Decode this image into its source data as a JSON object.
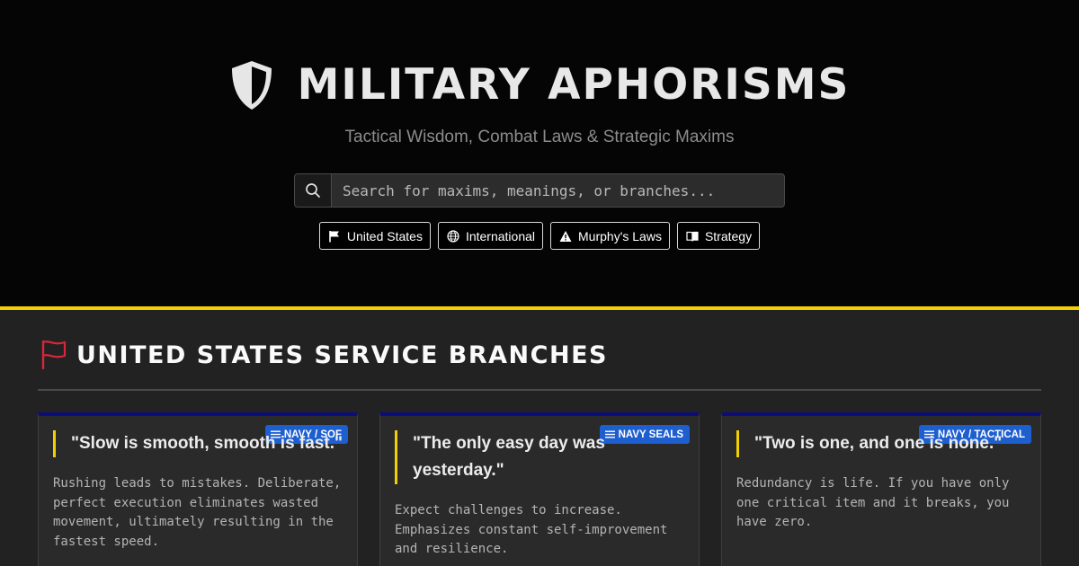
{
  "header": {
    "title": "MILITARY APHORISMS",
    "subtitle": "Tactical Wisdom, Combat Laws & Strategic Maxims",
    "search_placeholder": "Search for maxims, meanings, or branches...",
    "filters": [
      {
        "label": "United States",
        "icon": "flag-icon"
      },
      {
        "label": "International",
        "icon": "globe-icon"
      },
      {
        "label": "Murphy's Laws",
        "icon": "warning-icon"
      },
      {
        "label": "Strategy",
        "icon": "book-icon"
      }
    ]
  },
  "section": {
    "title": "UNITED STATES SERVICE BRANCHES",
    "icon": "flag-icon",
    "cards": [
      {
        "badge": "NAVY / SOF",
        "quote": "\"Slow is smooth, smooth is fast.\"",
        "meaning": "Rushing leads to mistakes. Deliberate, perfect execution eliminates wasted movement, ultimately resulting in the fastest speed."
      },
      {
        "badge": "NAVY SEALS",
        "quote": "\"The only easy day was yesterday.\"",
        "meaning": "Expect challenges to increase. Emphasizes constant self-improvement and resilience."
      },
      {
        "badge": "NAVY / TACTICAL",
        "quote": "\"Two is one, and one is none.\"",
        "meaning": "Redundancy is life. If you have only one critical item and it breaks, you have zero."
      }
    ]
  },
  "colors": {
    "accent_yellow": "#f0d000",
    "badge_blue": "#1e5fd0",
    "card_top_border": "#0c0c7a",
    "flag_red": "#d8263a"
  }
}
